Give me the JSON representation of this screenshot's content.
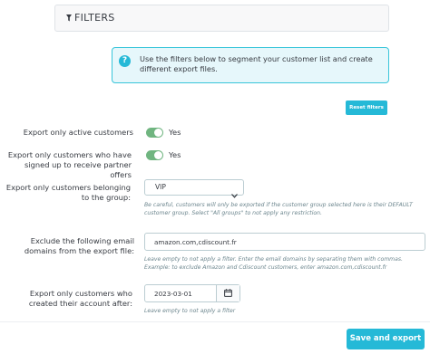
{
  "filters": {
    "title": "FILTERS",
    "icon": "filter-icon"
  },
  "info": {
    "icon": "question-icon",
    "text": "Use the filters below to segment your customer list and create different export files."
  },
  "reset_button": "Reset filters",
  "fields": {
    "active_customers": {
      "label": "Export only active customers",
      "toggle_on": true,
      "value": "Yes"
    },
    "partner_offers": {
      "label": "Export only customers who have signed up to receive partner offers",
      "toggle_on": true,
      "value": "Yes"
    },
    "customer_group": {
      "label": "Export only customers belonging to the group:",
      "selected": "VIP",
      "help": "Be careful, customers will only be exported if the customer group selected here is their DEFAULT customer group. Select \"All groups\" to not apply any restriction."
    },
    "exclude_domains": {
      "label": "Exclude the following email domains from the export file:",
      "value": "amazon.com,cdiscount.fr",
      "help": "Leave empty to not apply a filter. Enter the email domains by separating them with commas. Example: to exclude Amazon and Cdiscount customers, enter amazon.com,cdiscount.fr"
    },
    "created_after": {
      "label": "Export only customers who created their account after:",
      "value": "2023-03-01",
      "help": "Leave empty to not apply a filter"
    }
  },
  "save_button": "Save and export",
  "colors": {
    "accent": "#25b9d7",
    "toggle_on": "#70b580",
    "info_bg": "#e6f7fb",
    "info_border": "#38c5da"
  }
}
